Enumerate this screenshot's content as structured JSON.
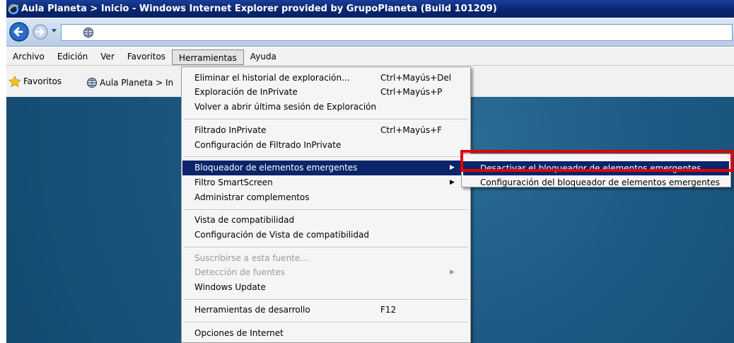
{
  "window": {
    "title": "Aula Planeta > Inicio - Windows Internet Explorer provided by GrupoPlaneta (Build 101209)"
  },
  "address": {
    "url": ""
  },
  "menubar": {
    "items": [
      "Archivo",
      "Edición",
      "Ver",
      "Favoritos",
      "Herramientas",
      "Ayuda"
    ],
    "open_item": "Herramientas"
  },
  "favorites_bar": {
    "favorites_label": "Favoritos",
    "tab_label": "Aula Planeta > In"
  },
  "tools_menu": {
    "items": [
      {
        "label": "Eliminar el historial de exploración...",
        "shortcut": "Ctrl+Mayús+Del"
      },
      {
        "label": "Exploración de InPrivate",
        "shortcut": "Ctrl+Mayús+P"
      },
      {
        "label": "Volver a abrir última sesión de Exploración",
        "shortcut": ""
      },
      {
        "label": "Filtrado InPrivate",
        "shortcut": "Ctrl+Mayús+F"
      },
      {
        "label": "Configuración de Filtrado InPrivate",
        "shortcut": ""
      },
      {
        "label": "Bloqueador de elementos emergentes",
        "shortcut": "",
        "submenu": true,
        "highlighted": true
      },
      {
        "label": "Filtro SmartScreen",
        "shortcut": "",
        "submenu": true
      },
      {
        "label": "Administrar complementos",
        "shortcut": ""
      },
      {
        "label": "Vista de compatibilidad",
        "shortcut": ""
      },
      {
        "label": "Configuración de Vista de compatibilidad",
        "shortcut": ""
      },
      {
        "label": "Suscribirse a esta fuente...",
        "shortcut": "",
        "disabled": true
      },
      {
        "label": "Detección de fuentes",
        "shortcut": "",
        "disabled": true,
        "submenu": true
      },
      {
        "label": "Windows Update",
        "shortcut": ""
      },
      {
        "label": "Herramientas de desarrollo",
        "shortcut": "F12"
      },
      {
        "label": "Opciones de Internet",
        "shortcut": ""
      }
    ]
  },
  "popup_submenu": {
    "items": [
      {
        "label": "Desactivar el bloqueador de elementos emergentes",
        "highlighted": true
      },
      {
        "label": "Configuración del bloqueador de elementos emergentes"
      }
    ]
  },
  "colors": {
    "highlight": "#0c246a",
    "callout": "#e10000",
    "content_background": "#1d5a83"
  },
  "icons": [
    "ie-logo-icon",
    "back-arrow-icon",
    "forward-arrow-icon",
    "dropdown-icon",
    "page-globe-icon",
    "star-icon",
    "tab-globe-icon",
    "submenu-arrow-icon"
  ]
}
